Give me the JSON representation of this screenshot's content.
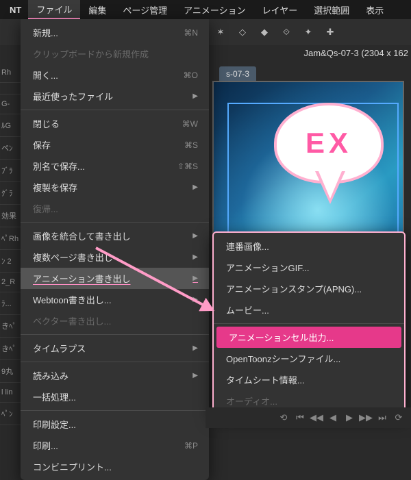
{
  "menubar": {
    "app": "NT",
    "items": [
      "ファイル",
      "編集",
      "ページ管理",
      "アニメーション",
      "レイヤー",
      "選択範囲",
      "表示"
    ],
    "active_index": 0
  },
  "doc": {
    "info": "Jam&Qs-07-3 (2304 x 162",
    "tab": "s-07-3"
  },
  "file_menu": [
    {
      "label": "新規...",
      "shortcut": "⌘N"
    },
    {
      "label": "クリップボードから新規作成",
      "disabled": true
    },
    {
      "label": "開く...",
      "shortcut": "⌘O"
    },
    {
      "label": "最近使ったファイル",
      "arrow": true
    },
    {
      "sep": true
    },
    {
      "label": "閉じる",
      "shortcut": "⌘W"
    },
    {
      "label": "保存",
      "shortcut": "⌘S"
    },
    {
      "label": "別名で保存...",
      "shortcut": "⇧⌘S"
    },
    {
      "label": "複製を保存",
      "arrow": true
    },
    {
      "label": "復帰...",
      "disabled": true
    },
    {
      "sep": true
    },
    {
      "label": "画像を統合して書き出し",
      "arrow": true
    },
    {
      "label": "複数ページ書き出し",
      "arrow": true
    },
    {
      "label": "アニメーション書き出し",
      "arrow": true,
      "highlight": true
    },
    {
      "label": "Webtoon書き出し...",
      "arrow": true
    },
    {
      "label": "ベクター書き出し...",
      "disabled": true
    },
    {
      "sep": true
    },
    {
      "label": "タイムラプス",
      "arrow": true
    },
    {
      "sep": true
    },
    {
      "label": "読み込み",
      "arrow": true
    },
    {
      "label": "一括処理..."
    },
    {
      "sep": true
    },
    {
      "label": "印刷設定..."
    },
    {
      "label": "印刷...",
      "shortcut": "⌘P"
    },
    {
      "label": "コンビニプリント..."
    }
  ],
  "submenu": [
    {
      "label": "連番画像..."
    },
    {
      "label": "アニメーションGIF..."
    },
    {
      "label": "アニメーションスタンプ(APNG)..."
    },
    {
      "label": "ムービー..."
    },
    {
      "sep": true
    },
    {
      "label": "アニメーションセル出力...",
      "selected": true
    },
    {
      "label": "OpenToonzシーンファイル..."
    },
    {
      "label": "タイムシート情報..."
    },
    {
      "label": "オーディオ...",
      "disabled": true
    }
  ],
  "bubble": {
    "text": "EX"
  },
  "sidebar": [
    "Rh",
    "",
    "G-",
    "ﾙG",
    "ペﾝ",
    "ﾌﾞﾗ",
    "ｸﾞﾗ",
    "効果",
    "ﾍﾟRh",
    "ﾝ 2",
    "2_R",
    "ﾗ...",
    "きﾍﾟ",
    "きﾍﾟ",
    "9丸",
    "l lin",
    "ﾍﾟﾝ"
  ],
  "playback": [
    "⟲",
    "⏮",
    "◀◀",
    "◀",
    "▶",
    "▶▶",
    "⏭",
    "⟳"
  ]
}
